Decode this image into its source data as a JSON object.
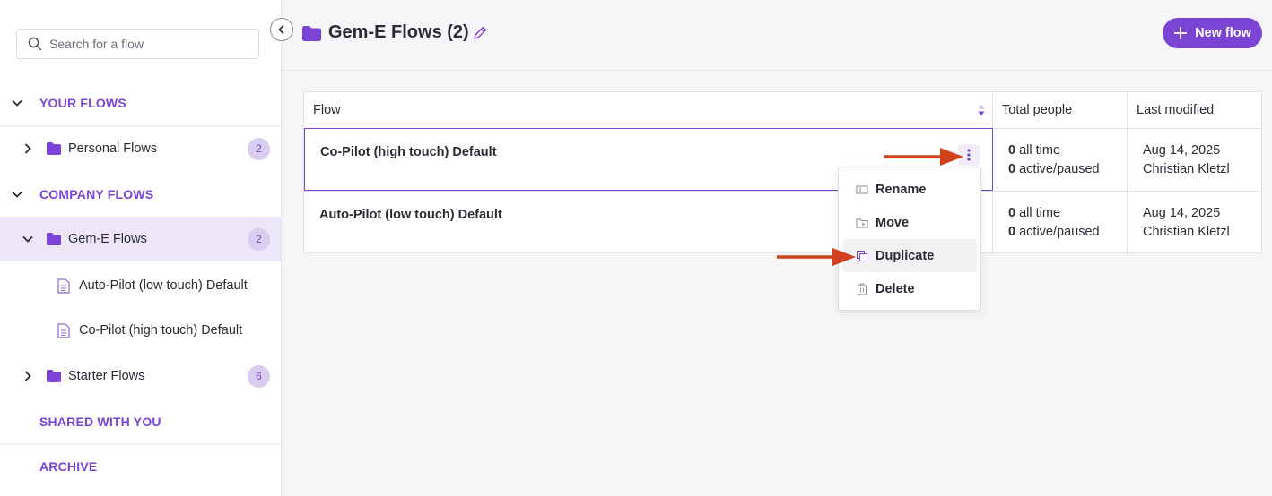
{
  "sidebar": {
    "search_placeholder": "Search for a flow",
    "your_flows_label": "YOUR FLOWS",
    "personal_flows": {
      "label": "Personal Flows",
      "count": "2"
    },
    "company_flows_label": "COMPANY FLOWS",
    "gem_flows": {
      "label": "Gem-E Flows",
      "count": "2",
      "children": [
        "Auto-Pilot (low touch) Default",
        "Co-Pilot (high touch) Default"
      ]
    },
    "starter_flows": {
      "label": "Starter Flows",
      "count": "6"
    },
    "shared_label": "SHARED WITH YOU",
    "archive_label": "ARCHIVE"
  },
  "header": {
    "title": "Gem-E Flows (2)",
    "new_flow_label": "New flow"
  },
  "table": {
    "columns": [
      "Flow",
      "Total people",
      "Last modified"
    ],
    "rows": [
      {
        "name": "Co-Pilot (high touch) Default",
        "all_time_count": "0",
        "all_time_label": "all time",
        "active_count": "0",
        "active_label": "active/paused",
        "date": "Aug 14, 2025",
        "author": "Christian Kletzl"
      },
      {
        "name": "Auto-Pilot (low touch) Default",
        "all_time_count": "0",
        "all_time_label": "all time",
        "active_count": "0",
        "active_label": "active/paused",
        "date": "Aug 14, 2025",
        "author": "Christian Kletzl"
      }
    ]
  },
  "context_menu": {
    "items": [
      "Rename",
      "Move",
      "Duplicate",
      "Delete"
    ]
  },
  "colors": {
    "accent": "#7a44d4",
    "annotation_arrow": "#d0411c",
    "active_row_bg": "#ece6f8"
  }
}
